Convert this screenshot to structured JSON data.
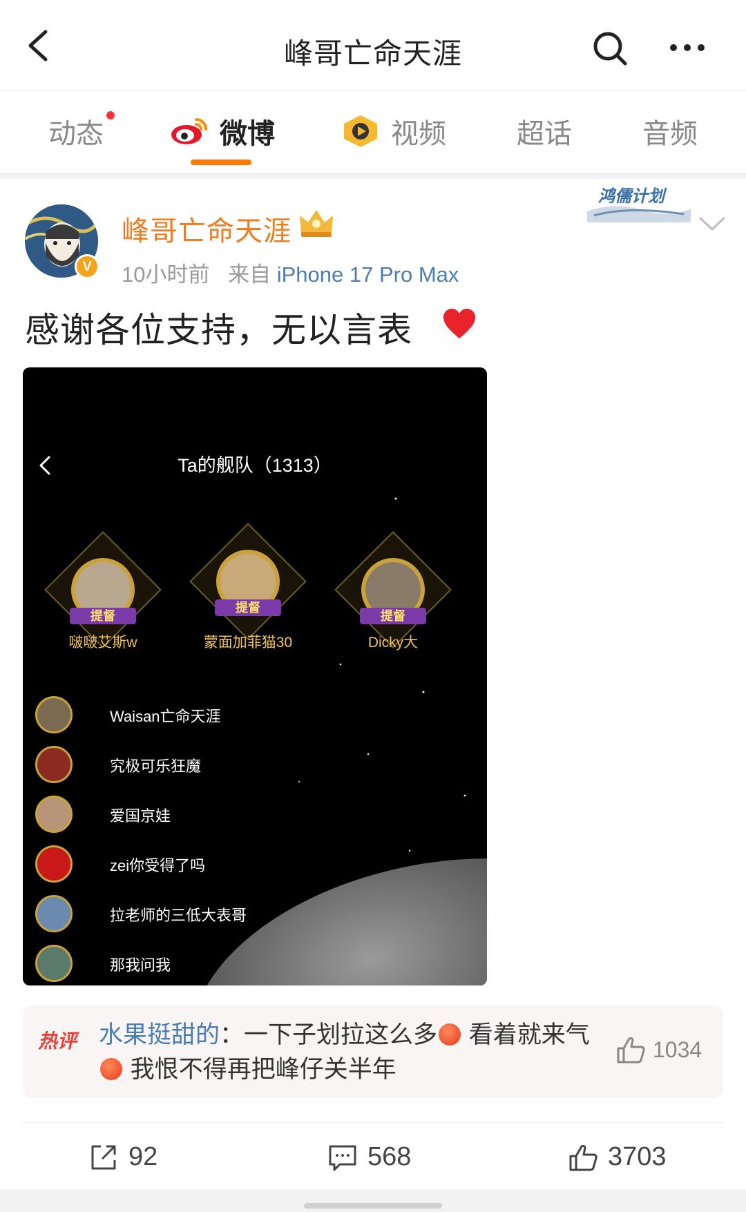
{
  "header": {
    "title": "峰哥亡命天涯"
  },
  "tabs": [
    {
      "label": "动态",
      "has_dot": true
    },
    {
      "label": "微博",
      "active": true
    },
    {
      "label": "视频"
    },
    {
      "label": "超话"
    },
    {
      "label": "音频"
    }
  ],
  "post": {
    "username": "峰哥亡命天涯",
    "time": "10小时前",
    "source_prefix": "来自",
    "device": "iPhone 17 Pro Max",
    "plan_badge": "鸿儒计划",
    "verify_mark": "V",
    "text": "感谢各位支持，无以言表"
  },
  "embed": {
    "title": "Ta的舰队（1313）",
    "podium": [
      {
        "name": "啵啵艾斯w",
        "rank_label": "提督"
      },
      {
        "name": "蒙面加菲猫30",
        "rank_label": "提督"
      },
      {
        "name": "Dicky大",
        "rank_label": "提督"
      }
    ],
    "fleet": [
      {
        "name": "Waisan亡命天涯"
      },
      {
        "name": "究极可乐狂魔"
      },
      {
        "name": "爱国京娃"
      },
      {
        "name": "zei你受得了吗"
      },
      {
        "name": "拉老师的三低大表哥"
      },
      {
        "name": "那我问我"
      }
    ]
  },
  "hot_comment": {
    "tag": "热评",
    "user": "水果挺甜的",
    "separator": "：",
    "text_part1": "一下子划拉这么多",
    "text_part2": "看着就来气",
    "text_part3": "我恨不得再把峰仔关半年",
    "likes": "1034"
  },
  "actions": {
    "reposts": "92",
    "comments": "568",
    "likes": "3703"
  },
  "colors": {
    "accent": "#ff7a00",
    "username": "#f07c1e",
    "link": "#4a7cb5",
    "hot_tag": "#e8413a"
  }
}
